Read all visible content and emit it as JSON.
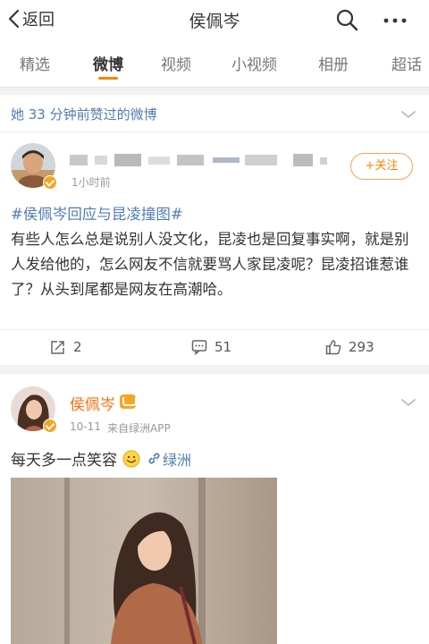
{
  "header": {
    "back_label": "返回",
    "title": "侯佩岑"
  },
  "tabs": [
    {
      "label": "精选"
    },
    {
      "label": "微博",
      "active": true
    },
    {
      "label": "视频"
    },
    {
      "label": "小视频"
    },
    {
      "label": "相册"
    },
    {
      "label": "超话"
    }
  ],
  "liked_banner": "她 33 分钟前赞过的微博",
  "post1": {
    "time": "1小时前",
    "follow_label": "+关注",
    "hashtag": "#侯佩岑回应与昆凌撞图#",
    "text": "有些人怎么总是说别人没文化，昆凌也是回复事实啊，就是别人发给他的，怎么网友不信就要骂人家昆凌呢？昆凌招谁惹谁了？从头到尾都是网友在高潮哈。",
    "reposts": "2",
    "comments": "51",
    "likes": "293"
  },
  "post2": {
    "author": "侯佩岑",
    "date": "10-11",
    "source": "来自绿洲APP",
    "text": "每天多一点笑容",
    "link_label": "绿洲"
  },
  "colors": {
    "accent": "#ff8200",
    "link": "#507daf",
    "author_name": "#f86e0f"
  },
  "icons": [
    "chevron-left-icon",
    "search-icon",
    "more-icon",
    "chevron-down-icon",
    "verified-badge-icon",
    "repost-icon",
    "comment-icon",
    "like-icon",
    "smile-emoji-icon",
    "link-icon",
    "vip-badge-icon"
  ]
}
